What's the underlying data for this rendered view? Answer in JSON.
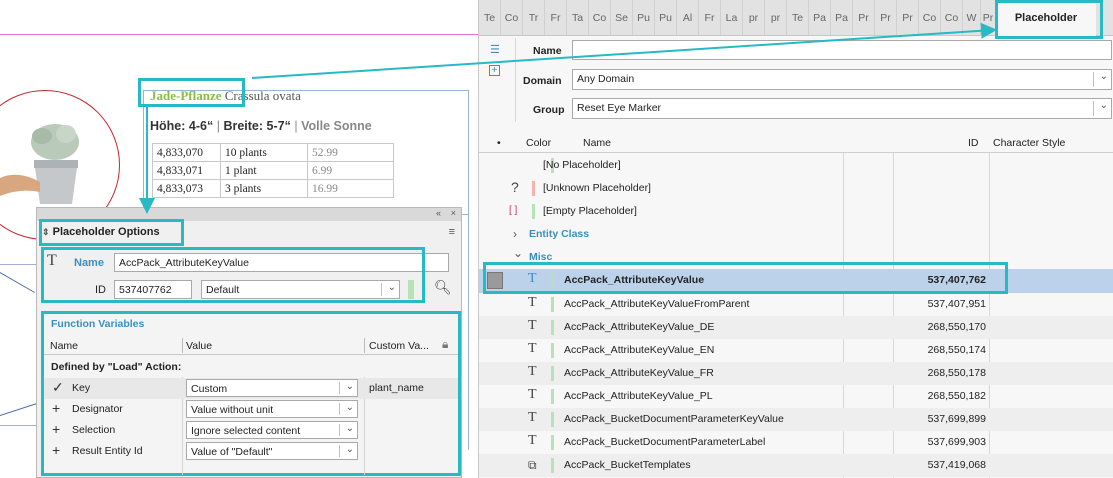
{
  "document": {
    "title_name": "Jade-Pflanze",
    "title_latin": "Crassula ovata",
    "height_label": "Höhe:",
    "height_value": "4-6“",
    "width_label": "Breite:",
    "width_value": "5-7“",
    "sun_label": "Volle Sonne",
    "separator": "|",
    "rows": [
      {
        "id": "4,833,070",
        "qty": "10 plants",
        "price": "52.99"
      },
      {
        "id": "4,833,071",
        "qty": "1 plant",
        "price": "6.99"
      },
      {
        "id": "4,833,073",
        "qty": "3 plants",
        "price": "16.99"
      }
    ]
  },
  "placeholder_options": {
    "title": "Placeholder Options",
    "collapse_glyph": "«",
    "close_glyph": "×",
    "menu_glyph": "≡",
    "name_label": "Name",
    "name_value": "AccPack_AttributeKeyValue",
    "id_label": "ID",
    "id_value": "537407762",
    "style_value": "Default",
    "function_variables": {
      "title": "Function Variables",
      "col_name": "Name",
      "col_value": "Value",
      "col_custom": "Custom Va...",
      "defined_by": "Defined by \"Load\" Action:",
      "rows": [
        {
          "icon": "✓",
          "icon_name": "check-icon",
          "name": "Key",
          "value": "Custom",
          "custom": "plant_name"
        },
        {
          "icon": "+",
          "icon_name": "plus-icon",
          "name": "Designator",
          "value": "Value without unit",
          "custom": ""
        },
        {
          "icon": "+",
          "icon_name": "plus-icon",
          "name": "Selection",
          "value": "Ignore selected content",
          "custom": ""
        },
        {
          "icon": "+",
          "icon_name": "plus-icon",
          "name": "Result Entity Id",
          "value": "Value of \"Default\"",
          "custom": ""
        }
      ]
    }
  },
  "right_panel": {
    "tabs": [
      "Te",
      "Co",
      "Tr",
      "Fr",
      "Ta",
      "Co",
      "Se",
      "Pu",
      "Pu",
      "Al",
      "Fr",
      "La",
      "pr",
      "pr",
      "Te",
      "Pa",
      "Pa",
      "Pr",
      "Pr",
      "Pr",
      "Co",
      "Co",
      "W",
      "Pr"
    ],
    "active_tab": "Placeholder",
    "name_label": "Name",
    "name_value": "",
    "domain_label": "Domain",
    "domain_value": "Any Domain",
    "group_label": "Group",
    "group_value": "Reset Eye Marker",
    "col_bullet": "•",
    "col_color": "Color",
    "col_name": "Name",
    "col_id": "ID",
    "col_style": "Character Style",
    "special_rows": [
      {
        "icon": "",
        "name": "[No Placeholder]",
        "swatch": "#b6e3b6"
      },
      {
        "icon": "?",
        "name": "[Unknown Placeholder]",
        "swatch": "#f4b3b3"
      },
      {
        "icon": "[ ]",
        "name": "[Empty Placeholder]",
        "swatch": "#b6e3b6"
      }
    ],
    "groups": {
      "entity_class": "Entity Class",
      "misc": "Misc"
    },
    "items": [
      {
        "icon": "T",
        "name": "AccPack_AttributeKeyValue",
        "id": "537,407,762",
        "selected": true
      },
      {
        "icon": "T",
        "name": "AccPack_AttributeKeyValueFromParent",
        "id": "537,407,951",
        "selected": false
      },
      {
        "icon": "T",
        "name": "AccPack_AttributeKeyValue_DE",
        "id": "268,550,170",
        "selected": false
      },
      {
        "icon": "T",
        "name": "AccPack_AttributeKeyValue_EN",
        "id": "268,550,174",
        "selected": false
      },
      {
        "icon": "T",
        "name": "AccPack_AttributeKeyValue_FR",
        "id": "268,550,178",
        "selected": false
      },
      {
        "icon": "T",
        "name": "AccPack_AttributeKeyValue_PL",
        "id": "268,550,182",
        "selected": false
      },
      {
        "icon": "T",
        "name": "AccPack_BucketDocumentParameterKeyValue",
        "id": "537,699,899",
        "selected": false
      },
      {
        "icon": "T",
        "name": "AccPack_BucketDocumentParameterLabel",
        "id": "537,699,903",
        "selected": false
      },
      {
        "icon": "⧉",
        "name": "AccPack_BucketTemplates",
        "id": "537,419,068",
        "selected": false
      }
    ]
  },
  "colors": {
    "highlight": "#27b9c4",
    "accent": "#3b8fbf",
    "selected_row": "#bcd2ea",
    "jade_green": "#8dbb3f"
  }
}
